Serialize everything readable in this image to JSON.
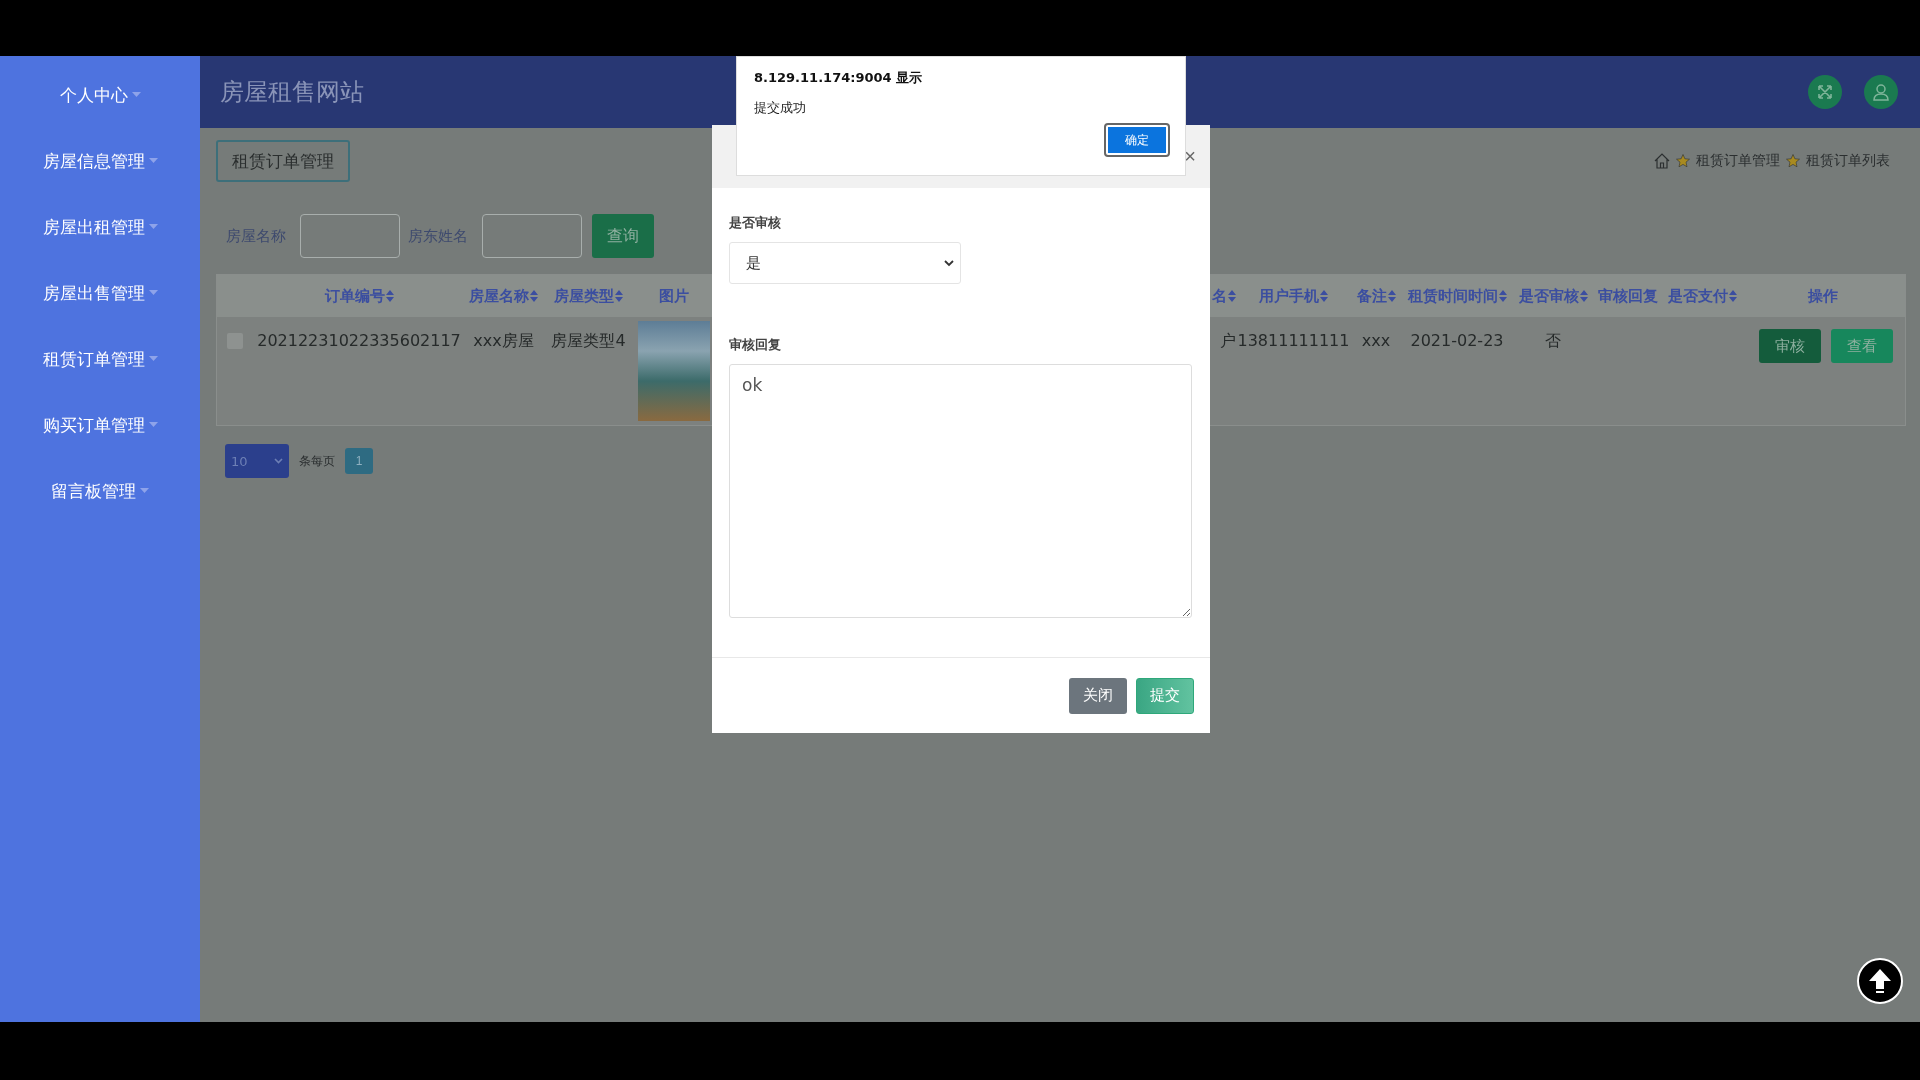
{
  "sidebar": {
    "items": [
      {
        "label": "个人中心"
      },
      {
        "label": "房屋信息管理"
      },
      {
        "label": "房屋出租管理"
      },
      {
        "label": "房屋出售管理"
      },
      {
        "label": "租赁订单管理"
      },
      {
        "label": "购买订单管理"
      },
      {
        "label": "留言板管理"
      }
    ]
  },
  "header": {
    "title": "房屋租售网站"
  },
  "page_button": "租赁订单管理",
  "breadcrumb": [
    "租赁订单管理",
    "租赁订单列表"
  ],
  "search": {
    "fields": [
      {
        "label": "房屋名称"
      },
      {
        "label": "房东姓名"
      }
    ],
    "button": "查询"
  },
  "table": {
    "columns": [
      {
        "label": "订单编号",
        "sortable": true
      },
      {
        "label": "房屋名称",
        "sortable": true
      },
      {
        "label": "房屋类型",
        "sortable": true
      },
      {
        "label": "图片",
        "sortable": false
      },
      {
        "label": "名",
        "sortable": true
      },
      {
        "label": "用户手机",
        "sortable": true
      },
      {
        "label": "备注",
        "sortable": true
      },
      {
        "label": "租赁时间时间",
        "sortable": true
      },
      {
        "label": "是否审核",
        "sortable": true
      },
      {
        "label": "审核回复",
        "sortable": false
      },
      {
        "label": "是否支付",
        "sortable": true
      },
      {
        "label": "操作",
        "sortable": false
      }
    ],
    "rows": [
      {
        "checked": false,
        "cells": [
          {
            "kind": "text",
            "text": "20212231022335602117"
          },
          {
            "kind": "text",
            "text": "xxx房屋"
          },
          {
            "kind": "text",
            "text": "房屋类型4"
          },
          {
            "kind": "image"
          },
          {
            "kind": "text",
            "text": "户"
          },
          {
            "kind": "text",
            "text": "13811111111"
          },
          {
            "kind": "text",
            "text": "xxx"
          },
          {
            "kind": "text",
            "text": "2021-02-23"
          },
          {
            "kind": "text",
            "text": "否"
          },
          {
            "kind": "blank"
          },
          {
            "kind": "blank"
          }
        ],
        "actions": [
          {
            "label": "审核",
            "kind": "dark"
          },
          {
            "label": "查看",
            "kind": "light"
          }
        ]
      }
    ]
  },
  "pagination": {
    "page_size": "10",
    "label": "条每页",
    "pages": [
      {
        "label": "1",
        "selected": true
      }
    ]
  },
  "modal": {
    "close": "×",
    "fields": [
      {
        "kind": "select",
        "label": "是否审核",
        "value": "是"
      },
      {
        "kind": "textarea",
        "label": "审核回复",
        "value": "ok"
      }
    ],
    "buttons": [
      {
        "label": "关闭",
        "kind": "secondary"
      },
      {
        "label": "提交",
        "kind": "primary"
      }
    ]
  },
  "alert": {
    "title": "8.129.11.174:9004 显示",
    "message": "提交成功",
    "button": "确定"
  }
}
